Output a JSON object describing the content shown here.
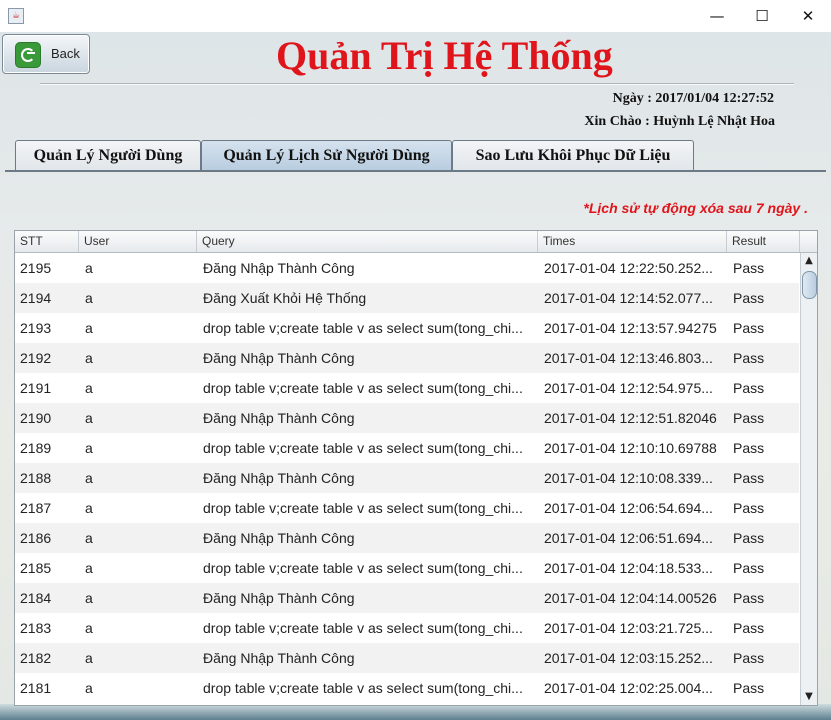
{
  "window": {
    "icon": "java-cup-icon",
    "minimize": "—",
    "maximize": "☐",
    "close": "✕"
  },
  "back_button": {
    "label": "Back",
    "icon": "back-arrow-icon"
  },
  "title": "Quản Trị Hệ Thống",
  "date_line": "Ngày : 2017/01/04 12:27:52",
  "hello_line": "Xin Chào : Huỳnh Lệ Nhật Hoa",
  "tabs": [
    {
      "label": "Quản Lý Người Dùng",
      "active": false
    },
    {
      "label": "Quản Lý Lịch Sử Người Dùng",
      "active": true
    },
    {
      "label": "Sao Lưu Khôi Phục Dữ Liệu",
      "active": false
    }
  ],
  "note": "*Lịch sử tự động xóa sau 7 ngày .",
  "table": {
    "columns": [
      "STT",
      "User",
      "Query",
      "Times",
      "Result"
    ],
    "rows": [
      [
        "2195",
        "a",
        "Đăng Nhập Thành Công",
        "2017-01-04 12:22:50.252...",
        "Pass"
      ],
      [
        "2194",
        "a",
        "Đăng Xuất Khỏi Hệ Thống",
        "2017-01-04 12:14:52.077...",
        "Pass"
      ],
      [
        "2193",
        "a",
        "drop table v;create table v as select sum(tong_chi...",
        "2017-01-04 12:13:57.94275",
        "Pass"
      ],
      [
        "2192",
        "a",
        "Đăng Nhập Thành Công",
        "2017-01-04 12:13:46.803...",
        "Pass"
      ],
      [
        "2191",
        "a",
        "drop table v;create table v as select sum(tong_chi...",
        "2017-01-04 12:12:54.975...",
        "Pass"
      ],
      [
        "2190",
        "a",
        "Đăng Nhập Thành Công",
        "2017-01-04 12:12:51.82046",
        "Pass"
      ],
      [
        "2189",
        "a",
        "drop table v;create table v as select sum(tong_chi...",
        "2017-01-04 12:10:10.69788",
        "Pass"
      ],
      [
        "2188",
        "a",
        "Đăng Nhập Thành Công",
        "2017-01-04 12:10:08.339...",
        "Pass"
      ],
      [
        "2187",
        "a",
        "drop table v;create table v as select sum(tong_chi...",
        "2017-01-04 12:06:54.694...",
        "Pass"
      ],
      [
        "2186",
        "a",
        "Đăng Nhập Thành Công",
        "2017-01-04 12:06:51.694...",
        "Pass"
      ],
      [
        "2185",
        "a",
        "drop table v;create table v as select sum(tong_chi...",
        "2017-01-04 12:04:18.533...",
        "Pass"
      ],
      [
        "2184",
        "a",
        "Đăng Nhập Thành Công",
        "2017-01-04 12:04:14.00526",
        "Pass"
      ],
      [
        "2183",
        "a",
        "drop table v;create table v as select sum(tong_chi...",
        "2017-01-04 12:03:21.725...",
        "Pass"
      ],
      [
        "2182",
        "a",
        "Đăng Nhập Thành Công",
        "2017-01-04 12:03:15.252...",
        "Pass"
      ],
      [
        "2181",
        "a",
        "drop table v;create table v as select sum(tong_chi...",
        "2017-01-04 12:02:25.004...",
        "Pass"
      ]
    ]
  },
  "colors": {
    "title": "#e0151b",
    "note": "#e0151b",
    "active_tab": "#c6d8ea"
  }
}
